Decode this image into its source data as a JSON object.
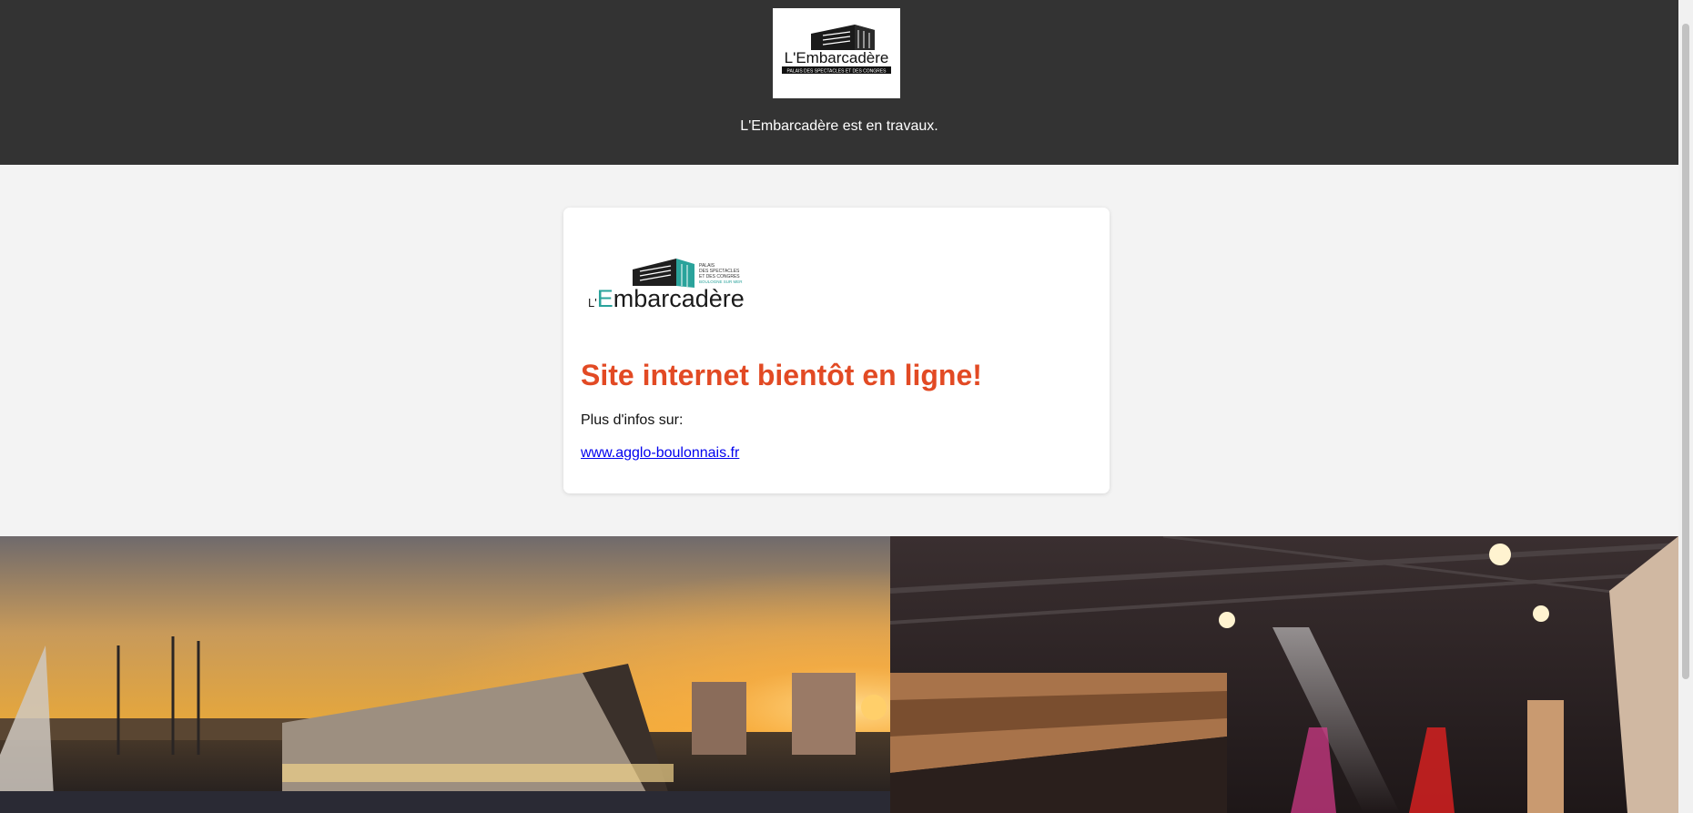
{
  "header": {
    "logo": {
      "name": "L'Embarcadère",
      "tagline": "PALAIS DES SPECTACLES ET DES CONGRES",
      "icon": "building-logo-icon"
    },
    "notice": "L'Embarcadère est en travaux."
  },
  "card": {
    "logo": {
      "name_prefix": "L'",
      "name_accent": "E",
      "name_rest": "mbarcadère",
      "tagline_lines": [
        "PALAIS",
        "DES SPECTACLES",
        "ET DES CONGRES",
        "BOULOGNE SUR MER"
      ]
    },
    "headline": "Site internet bientôt en ligne!",
    "info_text": "Plus d'infos sur:",
    "link_text": "www.agglo-boulonnais.fr"
  },
  "banner": {
    "left_image": "exterior-rendering-at-sunset",
    "right_image": "concert-hall-interior-rendering"
  },
  "colors": {
    "header_bg": "#333333",
    "page_bg": "#f3f3f3",
    "headline": "#e24a24",
    "logo_teal": "#2aa39b",
    "link": "#0000ee"
  }
}
